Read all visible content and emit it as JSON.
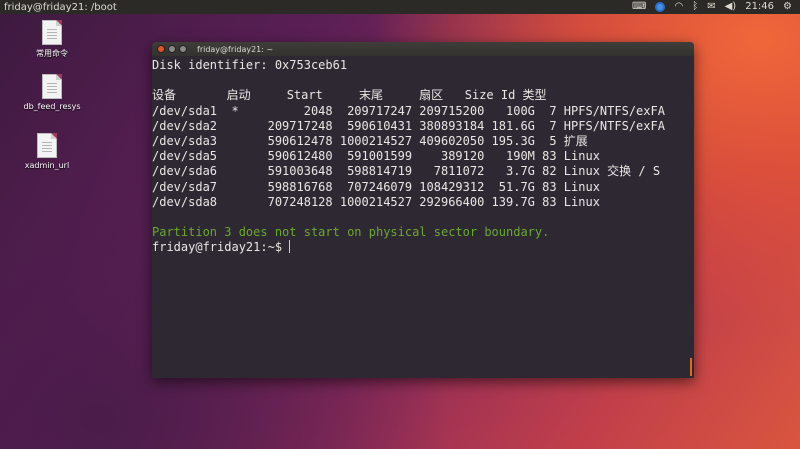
{
  "panel": {
    "window_title": "friday@friday21: /boot",
    "clock": "21:46",
    "tray_icons": [
      "keyboard-icon",
      "chrome-icon",
      "wifi-icon",
      "bluetooth-icon",
      "mail-icon",
      "volume-icon",
      "power-icon"
    ]
  },
  "desktop": {
    "icons": [
      {
        "label": "常用命令",
        "icon": "text-file-icon"
      },
      {
        "label": "db_feed_resys",
        "icon": "text-file-icon"
      },
      {
        "label": "xadmin_url",
        "icon": "text-file-icon"
      }
    ]
  },
  "terminal": {
    "title": "friday@friday21: ~",
    "disk_identifier_line": "Disk identifier: 0x753ceb61",
    "table_header": "设备       启动     Start     末尾     扇区   Size Id 类型",
    "rows": [
      "/dev/sda1  *         2048  209717247 209715200   100G  7 HPFS/NTFS/exFA",
      "/dev/sda2       209717248  590610431 380893184 181.6G  7 HPFS/NTFS/exFA",
      "/dev/sda3       590612478 1000214527 409602050 195.3G  5 扩展",
      "/dev/sda5       590612480  591001599    389120   190M 83 Linux",
      "/dev/sda6       591003648  598814719   7811072   3.7G 82 Linux 交换 / S",
      "/dev/sda7       598816768  707246079 108429312  51.7G 83 Linux",
      "/dev/sda8       707248128 1000214527 292966400 139.7G 83 Linux"
    ],
    "warning": "Partition 3 does not start on physical sector boundary.",
    "prompt": "friday@friday21:~$ "
  },
  "colors": {
    "terminal_bg": "#2e2833",
    "warning_green": "#6aa832",
    "scroll_accent": "#e2681e"
  }
}
